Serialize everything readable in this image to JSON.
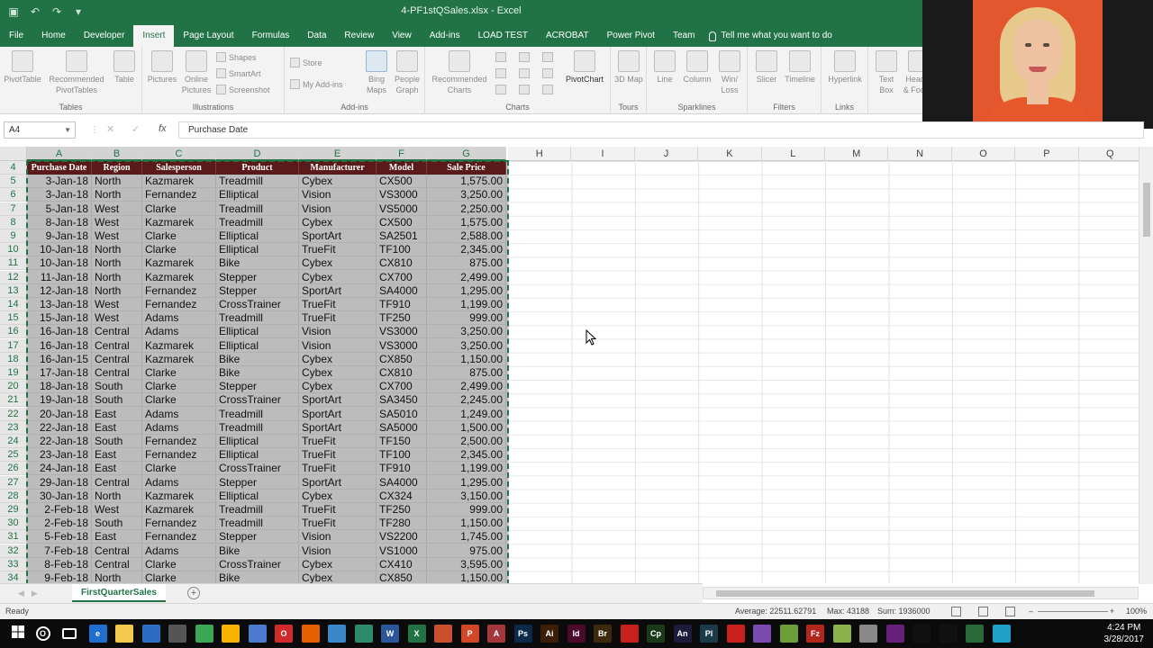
{
  "app": {
    "window_title": "4-PF1stQSales.xlsx - Excel",
    "qat": [
      "save-icon",
      "undo-icon",
      "redo-icon",
      "customize-icon"
    ]
  },
  "ribbon": {
    "tabs": [
      "File",
      "Home",
      "Developer",
      "Insert",
      "Page Layout",
      "Formulas",
      "Data",
      "Review",
      "View",
      "Add-ins",
      "LOAD TEST",
      "ACROBAT",
      "Power Pivot",
      "Team"
    ],
    "active_tab": "Insert",
    "tell_me": "Tell me what you want to do",
    "groups": {
      "tables": {
        "label": "Tables",
        "pivottable": "PivotTable",
        "recommended": "Recommended PivotTables",
        "table": "Table"
      },
      "illustrations": {
        "label": "Illustrations",
        "pictures": "Pictures",
        "online_pictures": "Online Pictures",
        "shapes": "Shapes",
        "smartart": "SmartArt",
        "screenshot": "Screenshot"
      },
      "addins": {
        "label": "Add-ins",
        "store": "Store",
        "my_addins": "My Add-ins",
        "bing_maps": "Bing Maps",
        "people_graph": "People Graph"
      },
      "charts": {
        "label": "Charts",
        "recommended_charts": "Recommended Charts",
        "pivotchart": "PivotChart"
      },
      "tours": {
        "label": "Tours",
        "map3d": "3D Map"
      },
      "sparklines": {
        "label": "Sparklines",
        "line": "Line",
        "column": "Column",
        "winloss": "Win/ Loss"
      },
      "filters": {
        "label": "Filters",
        "slicer": "Slicer",
        "timeline": "Timeline"
      },
      "links": {
        "label": "Links",
        "hyperlink": "Hyperlink"
      },
      "text": {
        "text_box": "Text Box",
        "header_footer": "Header & Footer"
      }
    }
  },
  "formula_bar": {
    "name_box": "A4",
    "fx": "fx",
    "formula": "Purchase Date"
  },
  "columns": [
    "A",
    "B",
    "C",
    "D",
    "E",
    "F",
    "G",
    "H",
    "I",
    "J",
    "K",
    "L",
    "M",
    "N",
    "O",
    "P",
    "Q"
  ],
  "table": {
    "header_row": "4",
    "headers": [
      "Purchase Date",
      "Region",
      "Salesperson",
      "Product",
      "Manufacturer",
      "Model",
      "Sale Price"
    ],
    "rows": [
      {
        "row": "5",
        "cells": [
          "3-Jan-18",
          "North",
          "Kazmarek",
          "Treadmill",
          "Cybex",
          "CX500",
          "1,575.00"
        ]
      },
      {
        "row": "6",
        "cells": [
          "3-Jan-18",
          "North",
          "Fernandez",
          "Elliptical",
          "Vision",
          "VS3000",
          "3,250.00"
        ]
      },
      {
        "row": "7",
        "cells": [
          "5-Jan-18",
          "West",
          "Clarke",
          "Treadmill",
          "Vision",
          "VS5000",
          "2,250.00"
        ]
      },
      {
        "row": "8",
        "cells": [
          "8-Jan-18",
          "West",
          "Kazmarek",
          "Treadmill",
          "Cybex",
          "CX500",
          "1,575.00"
        ]
      },
      {
        "row": "9",
        "cells": [
          "9-Jan-18",
          "West",
          "Clarke",
          "Elliptical",
          "SportArt",
          "SA2501",
          "2,588.00"
        ]
      },
      {
        "row": "10",
        "cells": [
          "10-Jan-18",
          "North",
          "Clarke",
          "Elliptical",
          "TrueFit",
          "TF100",
          "2,345.00"
        ]
      },
      {
        "row": "11",
        "cells": [
          "10-Jan-18",
          "North",
          "Kazmarek",
          "Bike",
          "Cybex",
          "CX810",
          "875.00"
        ]
      },
      {
        "row": "12",
        "cells": [
          "11-Jan-18",
          "North",
          "Kazmarek",
          "Stepper",
          "Cybex",
          "CX700",
          "2,499.00"
        ]
      },
      {
        "row": "13",
        "cells": [
          "12-Jan-18",
          "North",
          "Fernandez",
          "Stepper",
          "SportArt",
          "SA4000",
          "1,295.00"
        ]
      },
      {
        "row": "14",
        "cells": [
          "13-Jan-18",
          "West",
          "Fernandez",
          "CrossTrainer",
          "TrueFit",
          "TF910",
          "1,199.00"
        ]
      },
      {
        "row": "15",
        "cells": [
          "15-Jan-18",
          "West",
          "Adams",
          "Treadmill",
          "TrueFit",
          "TF250",
          "999.00"
        ]
      },
      {
        "row": "16",
        "cells": [
          "16-Jan-18",
          "Central",
          "Adams",
          "Elliptical",
          "Vision",
          "VS3000",
          "3,250.00"
        ]
      },
      {
        "row": "17",
        "cells": [
          "16-Jan-18",
          "Central",
          "Kazmarek",
          "Elliptical",
          "Vision",
          "VS3000",
          "3,250.00"
        ]
      },
      {
        "row": "18",
        "cells": [
          "16-Jan-15",
          "Central",
          "Kazmarek",
          "Bike",
          "Cybex",
          "CX850",
          "1,150.00"
        ]
      },
      {
        "row": "19",
        "cells": [
          "17-Jan-18",
          "Central",
          "Clarke",
          "Bike",
          "Cybex",
          "CX810",
          "875.00"
        ]
      },
      {
        "row": "20",
        "cells": [
          "18-Jan-18",
          "South",
          "Clarke",
          "Stepper",
          "Cybex",
          "CX700",
          "2,499.00"
        ]
      },
      {
        "row": "21",
        "cells": [
          "19-Jan-18",
          "South",
          "Clarke",
          "CrossTrainer",
          "SportArt",
          "SA3450",
          "2,245.00"
        ]
      },
      {
        "row": "22",
        "cells": [
          "20-Jan-18",
          "East",
          "Adams",
          "Treadmill",
          "SportArt",
          "SA5010",
          "1,249.00"
        ]
      },
      {
        "row": "23",
        "cells": [
          "22-Jan-18",
          "East",
          "Adams",
          "Treadmill",
          "SportArt",
          "SA5000",
          "1,500.00"
        ]
      },
      {
        "row": "24",
        "cells": [
          "22-Jan-18",
          "South",
          "Fernandez",
          "Elliptical",
          "TrueFit",
          "TF150",
          "2,500.00"
        ]
      },
      {
        "row": "25",
        "cells": [
          "23-Jan-18",
          "East",
          "Fernandez",
          "Elliptical",
          "TrueFit",
          "TF100",
          "2,345.00"
        ]
      },
      {
        "row": "26",
        "cells": [
          "24-Jan-18",
          "East",
          "Clarke",
          "CrossTrainer",
          "TrueFit",
          "TF910",
          "1,199.00"
        ]
      },
      {
        "row": "27",
        "cells": [
          "29-Jan-18",
          "Central",
          "Adams",
          "Stepper",
          "SportArt",
          "SA4000",
          "1,295.00"
        ]
      },
      {
        "row": "28",
        "cells": [
          "30-Jan-18",
          "North",
          "Kazmarek",
          "Elliptical",
          "Cybex",
          "CX324",
          "3,150.00"
        ]
      },
      {
        "row": "29",
        "cells": [
          "2-Feb-18",
          "West",
          "Kazmarek",
          "Treadmill",
          "TrueFit",
          "TF250",
          "999.00"
        ]
      },
      {
        "row": "30",
        "cells": [
          "2-Feb-18",
          "South",
          "Fernandez",
          "Treadmill",
          "TrueFit",
          "TF280",
          "1,150.00"
        ]
      },
      {
        "row": "31",
        "cells": [
          "5-Feb-18",
          "East",
          "Fernandez",
          "Stepper",
          "Vision",
          "VS2200",
          "1,745.00"
        ]
      },
      {
        "row": "32",
        "cells": [
          "7-Feb-18",
          "Central",
          "Adams",
          "Bike",
          "Vision",
          "VS1000",
          "975.00"
        ]
      },
      {
        "row": "33",
        "cells": [
          "8-Feb-18",
          "Central",
          "Clarke",
          "CrossTrainer",
          "Cybex",
          "CX410",
          "3,595.00"
        ]
      },
      {
        "row": "34",
        "cells": [
          "9-Feb-18",
          "North",
          "Clarke",
          "Bike",
          "Cybex",
          "CX850",
          "1,150.00"
        ]
      }
    ]
  },
  "sheet_tabs": {
    "active": "FirstQuarterSales",
    "add_label": "+"
  },
  "status_bar": {
    "mode": "Ready",
    "average": "Average: 22511.62791",
    "max": "Max: 43188",
    "sum": "Sum: 1936000",
    "zoom": "100%"
  },
  "taskbar": {
    "time": "4:24 PM",
    "date": "3/28/2017",
    "icons": [
      {
        "name": "windows-start-icon",
        "label": "",
        "color": "#ffffff"
      },
      {
        "name": "cortana-icon",
        "label": "O",
        "color": "#0b0b0b"
      },
      {
        "name": "task-view-icon",
        "label": "",
        "color": "#0b0b0b"
      },
      {
        "name": "edge-icon",
        "label": "e",
        "color": "#1f6fd1"
      },
      {
        "name": "file-explorer-icon",
        "label": "",
        "color": "#f2c94c"
      },
      {
        "name": "store-icon",
        "label": "",
        "color": "#2b6cc4"
      },
      {
        "name": "calculator-icon",
        "label": "",
        "color": "#555555"
      },
      {
        "name": "chrome-icon",
        "label": "",
        "color": "#3aa757"
      },
      {
        "name": "google-drive-icon",
        "label": "",
        "color": "#f4b400"
      },
      {
        "name": "browser-icon",
        "label": "",
        "color": "#4a7bd0"
      },
      {
        "name": "opera-icon",
        "label": "O",
        "color": "#d12a2a"
      },
      {
        "name": "firefox-icon",
        "label": "",
        "color": "#e66000"
      },
      {
        "name": "app-icon",
        "label": "",
        "color": "#3a88c8"
      },
      {
        "name": "camtasia-icon",
        "label": "",
        "color": "#2d8a6a"
      },
      {
        "name": "word-icon",
        "label": "W",
        "color": "#2b579a"
      },
      {
        "name": "excel-icon",
        "label": "X",
        "color": "#217346"
      },
      {
        "name": "app2-icon",
        "label": "",
        "color": "#c94f2d"
      },
      {
        "name": "powerpoint-icon",
        "label": "P",
        "color": "#d24726"
      },
      {
        "name": "access-icon",
        "label": "A",
        "color": "#a4373a"
      },
      {
        "name": "photoshop-icon",
        "label": "Ps",
        "color": "#0b2a4a"
      },
      {
        "name": "illustrator-icon",
        "label": "Ai",
        "color": "#3b1e08"
      },
      {
        "name": "indesign-icon",
        "label": "Id",
        "color": "#4a0a2c"
      },
      {
        "name": "bridge-icon",
        "label": "Br",
        "color": "#3d2a0a"
      },
      {
        "name": "acrobat-icon",
        "label": "",
        "color": "#c8201f"
      },
      {
        "name": "captivate-icon",
        "label": "Cp",
        "color": "#1a3a1a"
      },
      {
        "name": "animate-icon",
        "label": "An",
        "color": "#1b1b3a"
      },
      {
        "name": "prelude-icon",
        "label": "Pl",
        "color": "#1b3a4a"
      },
      {
        "name": "acrobat-dc-icon",
        "label": "",
        "color": "#c8201f"
      },
      {
        "name": "app3-icon",
        "label": "",
        "color": "#7a4ab0"
      },
      {
        "name": "app4-icon",
        "label": "",
        "color": "#6c9e3a"
      },
      {
        "name": "filezilla-icon",
        "label": "Fz",
        "color": "#b3261e"
      },
      {
        "name": "notepad-icon",
        "label": "",
        "color": "#8ab14a"
      },
      {
        "name": "app5-icon",
        "label": "",
        "color": "#888888"
      },
      {
        "name": "visual-studio-icon",
        "label": "",
        "color": "#68217a"
      },
      {
        "name": "app6-icon",
        "label": "",
        "color": "#111111"
      },
      {
        "name": "app7-icon",
        "label": "",
        "color": "#111111"
      },
      {
        "name": "app8-icon",
        "label": "",
        "color": "#2a6a3a"
      },
      {
        "name": "app9-icon",
        "label": "",
        "color": "#1ea0c8"
      }
    ]
  },
  "colors": {
    "excel_green": "#217346",
    "table_header_bg": "#5a1a1a",
    "selection_bg": "#bcbcbc"
  }
}
